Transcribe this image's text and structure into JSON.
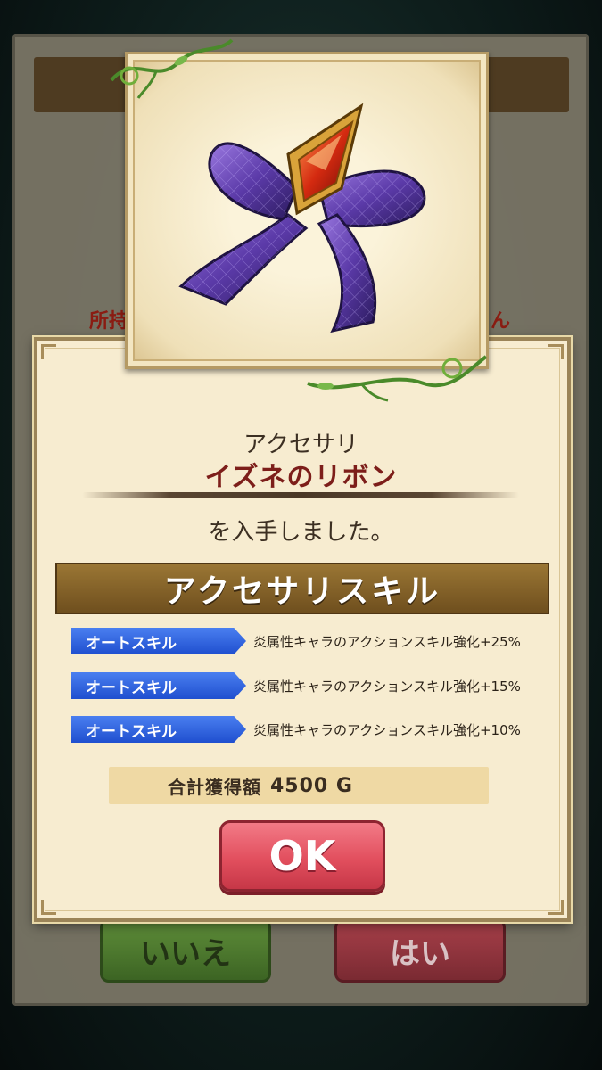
{
  "background": {
    "partial_text_left": "所持",
    "partial_text_right": "ん",
    "no_button": "いいえ",
    "yes_button": "はい"
  },
  "item": {
    "category": "アクセサリ",
    "name": "イズネのリボン",
    "icon": "purple-ribbon-icon",
    "obtained_text": "を入手しました。"
  },
  "skills": {
    "header": "アクセサリスキル",
    "list": [
      {
        "tag": "オートスキル",
        "description": "炎属性キャラのアクションスキル強化+25%"
      },
      {
        "tag": "オートスキル",
        "description": "炎属性キャラのアクションスキル強化+15%"
      },
      {
        "tag": "オートスキル",
        "description": "炎属性キャラのアクションスキル強化+10%"
      }
    ]
  },
  "total": {
    "label": "合計獲得額",
    "value": "4500 G"
  },
  "ok_button": "OK",
  "colors": {
    "item_name": "#7d1e1a",
    "skill_tag": "#1f4fcf",
    "ok_button": "#e24f5e",
    "header_banner": "#8a6a2c"
  }
}
